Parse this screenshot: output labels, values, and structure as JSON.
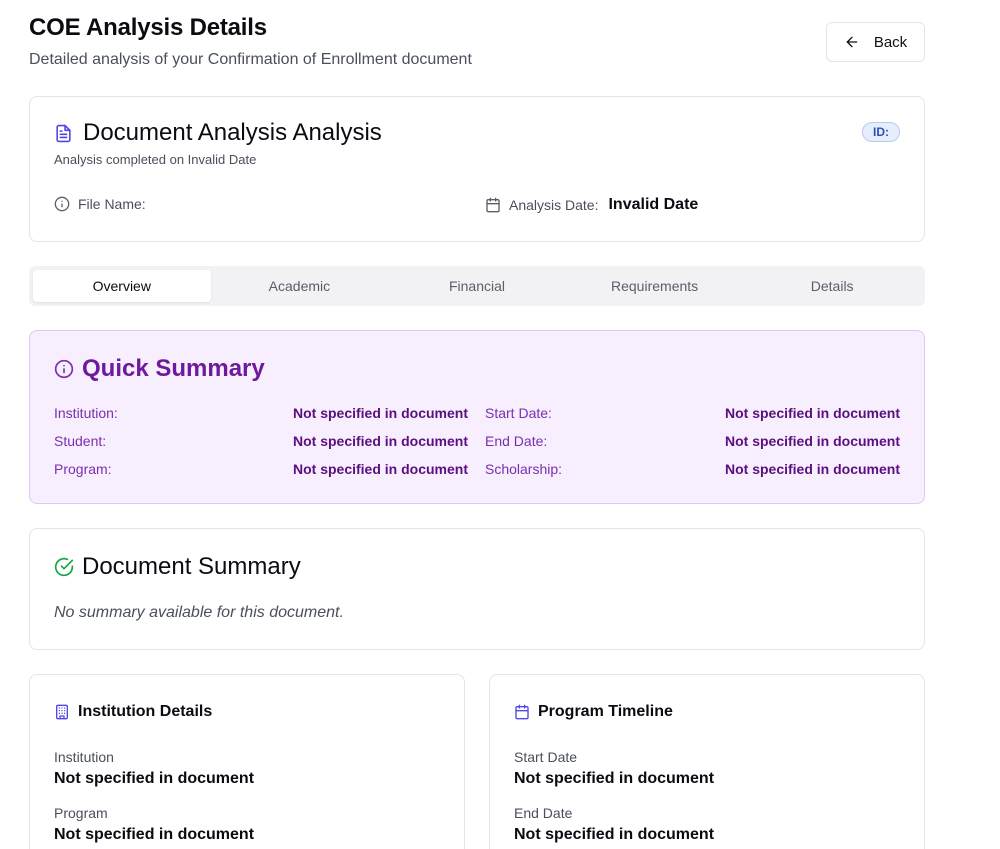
{
  "header": {
    "title": "COE Analysis Details",
    "subtitle": "Detailed analysis of your Confirmation of Enrollment document",
    "back_label": "Back"
  },
  "document": {
    "title": "Document Analysis Analysis",
    "completed_text": "Analysis completed on Invalid Date",
    "id_label": "ID:",
    "file_name_label": "File Name:",
    "file_name_value": "",
    "analysis_date_label": "Analysis Date:",
    "analysis_date_value": "Invalid Date"
  },
  "tabs": [
    {
      "label": "Overview",
      "active": true
    },
    {
      "label": "Academic",
      "active": false
    },
    {
      "label": "Financial",
      "active": false
    },
    {
      "label": "Requirements",
      "active": false
    },
    {
      "label": "Details",
      "active": false
    }
  ],
  "quick_summary": {
    "title": "Quick Summary",
    "left": [
      {
        "label": "Institution:",
        "value": "Not specified in document"
      },
      {
        "label": "Student:",
        "value": "Not specified in document"
      },
      {
        "label": "Program:",
        "value": "Not specified in document"
      }
    ],
    "right": [
      {
        "label": "Start Date:",
        "value": "Not specified in document"
      },
      {
        "label": "End Date:",
        "value": "Not specified in document"
      },
      {
        "label": "Scholarship:",
        "value": "Not specified in document"
      }
    ]
  },
  "document_summary": {
    "title": "Document Summary",
    "text": "No summary available for this document."
  },
  "institution_details": {
    "title": "Institution Details",
    "fields": [
      {
        "label": "Institution",
        "value": "Not specified in document"
      },
      {
        "label": "Program",
        "value": "Not specified in document"
      }
    ]
  },
  "program_timeline": {
    "title": "Program Timeline",
    "fields": [
      {
        "label": "Start Date",
        "value": "Not specified in document"
      },
      {
        "label": "End Date",
        "value": "Not specified in document"
      }
    ]
  },
  "colors": {
    "accent_blue": "#4f46e5",
    "purple_title": "#6d1a9c",
    "purple_bg": "#f7eefe",
    "green_check": "#16a34a",
    "badge_bg": "#e6edfd"
  }
}
